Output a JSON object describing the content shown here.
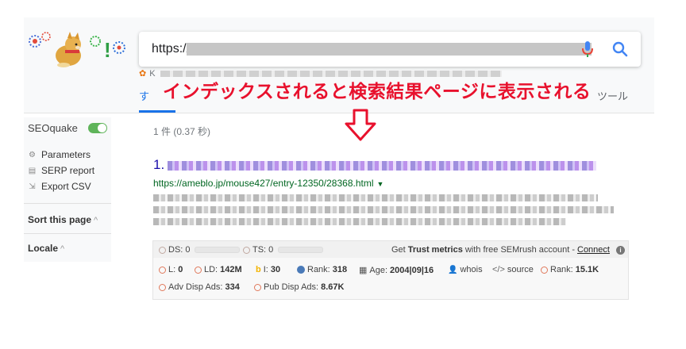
{
  "search": {
    "query_prefix": "https://",
    "tab_all": "す",
    "tab_tools": "ツール",
    "subline_prefix": "K"
  },
  "annotation": {
    "text": "インデックスされると検索結果ページに表示される",
    "color": "#e8112d"
  },
  "sidebar": {
    "title": "SEOquake",
    "items": [
      {
        "label": "Parameters",
        "icon": "gear-icon"
      },
      {
        "label": "SERP report",
        "icon": "table-icon"
      },
      {
        "label": "Export CSV",
        "icon": "export-icon"
      }
    ],
    "sort_label": "Sort this page",
    "locale_label": "Locale"
  },
  "results": {
    "count": "1 件  (0.37 秒)",
    "first": {
      "number": "1.",
      "url": "https://ameblo.jp/mouse427/entry-12350/28368.html"
    }
  },
  "seoquake_bar": {
    "ds_label": "DS:",
    "ds_value": "0",
    "ts_label": "TS:",
    "ts_value": "0",
    "trust_prefix": "Get ",
    "trust_bold": "Trust metrics",
    "trust_suffix": " with free SEMrush account - ",
    "connect": "Connect",
    "row1": [
      {
        "label": "L:",
        "value": "0"
      },
      {
        "label": "LD:",
        "value": "142M"
      },
      {
        "label": "I:",
        "value": "30"
      },
      {
        "label": "Rank:",
        "value": "318"
      },
      {
        "label": "Age:",
        "value": "2004|09|16"
      },
      {
        "label": "whois",
        "value": ""
      },
      {
        "label": "source",
        "value": ""
      },
      {
        "label": "Rank:",
        "value": "15.1K"
      }
    ],
    "row2": [
      {
        "label": "Adv Disp Ads:",
        "value": "334"
      },
      {
        "label": "Pub Disp Ads:",
        "value": "8.67K"
      }
    ]
  },
  "colors": {
    "link": "#1a0dab",
    "url_green": "#006621",
    "google_blue": "#1a73e8",
    "toggle_green": "#5fb45a",
    "seo_circle": "#e0785a"
  }
}
